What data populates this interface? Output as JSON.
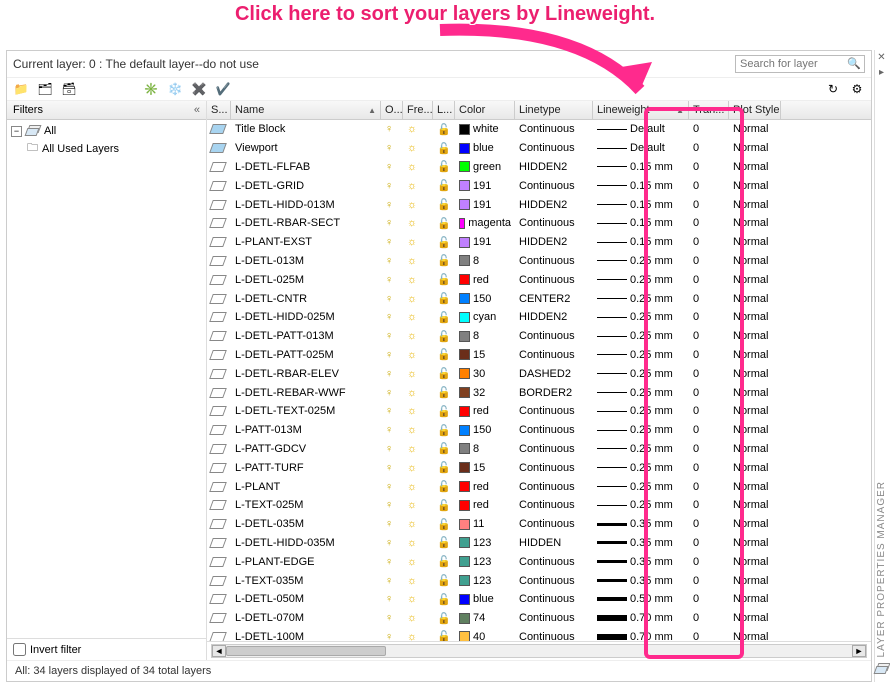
{
  "annotation": "Click here to sort your layers by Lineweight.",
  "title_line": "Current layer: 0 : The default layer--do not use",
  "search_placeholder": "Search for layer",
  "filters": {
    "header": "Filters",
    "root": "All",
    "child": "All Used Layers",
    "invert": "Invert filter"
  },
  "columns": {
    "s": "S...",
    "name": "Name",
    "on": "O...",
    "fre": "Fre...",
    "lock": "L...",
    "color": "Color",
    "ltype": "Linetype",
    "lw": "Lineweight",
    "tran": "Tran...",
    "plot": "Plot Style"
  },
  "status": "All: 34 layers displayed of 34 total layers",
  "side_label": "LAYER PROPERTIES MANAGER",
  "layers": [
    {
      "s": "blue",
      "name": "Title Block",
      "color": "#000000",
      "cname": "white",
      "ltype": "Continuous",
      "lw": "Default",
      "lwpx": 1,
      "tran": "0",
      "plot": "Normal"
    },
    {
      "s": "blue",
      "name": "Viewport",
      "color": "#0000ff",
      "cname": "blue",
      "ltype": "Continuous",
      "lw": "Default",
      "lwpx": 1,
      "tran": "0",
      "plot": "Normal"
    },
    {
      "s": "",
      "name": "L-DETL-FLFAB",
      "color": "#00ff00",
      "cname": "green",
      "ltype": "HIDDEN2",
      "lw": "0.15 mm",
      "lwpx": 1,
      "tran": "0",
      "plot": "Normal"
    },
    {
      "s": "",
      "name": "L-DETL-GRID",
      "color": "#c080ff",
      "cname": "191",
      "ltype": "Continuous",
      "lw": "0.15 mm",
      "lwpx": 1,
      "tran": "0",
      "plot": "Normal"
    },
    {
      "s": "",
      "name": "L-DETL-HIDD-013M",
      "color": "#c080ff",
      "cname": "191",
      "ltype": "HIDDEN2",
      "lw": "0.15 mm",
      "lwpx": 1,
      "tran": "0",
      "plot": "Normal"
    },
    {
      "s": "",
      "name": "L-DETL-RBAR-SECT",
      "color": "#ff00ff",
      "cname": "magenta",
      "ltype": "Continuous",
      "lw": "0.15 mm",
      "lwpx": 1,
      "tran": "0",
      "plot": "Normal"
    },
    {
      "s": "",
      "name": "L-PLANT-EXST",
      "color": "#c080ff",
      "cname": "191",
      "ltype": "HIDDEN2",
      "lw": "0.15 mm",
      "lwpx": 1,
      "tran": "0",
      "plot": "Normal"
    },
    {
      "s": "",
      "name": "L-DETL-013M",
      "color": "#808080",
      "cname": "8",
      "ltype": "Continuous",
      "lw": "0.25 mm",
      "lwpx": 1,
      "tran": "0",
      "plot": "Normal"
    },
    {
      "s": "",
      "name": "L-DETL-025M",
      "color": "#ff0000",
      "cname": "red",
      "ltype": "Continuous",
      "lw": "0.25 mm",
      "lwpx": 1,
      "tran": "0",
      "plot": "Normal"
    },
    {
      "s": "",
      "name": "L-DETL-CNTR",
      "color": "#0080ff",
      "cname": "150",
      "ltype": "CENTER2",
      "lw": "0.25 mm",
      "lwpx": 1,
      "tran": "0",
      "plot": "Normal"
    },
    {
      "s": "",
      "name": "L-DETL-HIDD-025M",
      "color": "#00ffff",
      "cname": "cyan",
      "ltype": "HIDDEN2",
      "lw": "0.25 mm",
      "lwpx": 1,
      "tran": "0",
      "plot": "Normal"
    },
    {
      "s": "",
      "name": "L-DETL-PATT-013M",
      "color": "#808080",
      "cname": "8",
      "ltype": "Continuous",
      "lw": "0.25 mm",
      "lwpx": 1,
      "tran": "0",
      "plot": "Normal"
    },
    {
      "s": "",
      "name": "L-DETL-PATT-025M",
      "color": "#6b2e1a",
      "cname": "15",
      "ltype": "Continuous",
      "lw": "0.25 mm",
      "lwpx": 1,
      "tran": "0",
      "plot": "Normal"
    },
    {
      "s": "",
      "name": "L-DETL-RBAR-ELEV",
      "color": "#ff8000",
      "cname": "30",
      "ltype": "DASHED2",
      "lw": "0.25 mm",
      "lwpx": 1,
      "tran": "0",
      "plot": "Normal"
    },
    {
      "s": "",
      "name": "L-DETL-REBAR-WWF",
      "color": "#804020",
      "cname": "32",
      "ltype": "BORDER2",
      "lw": "0.25 mm",
      "lwpx": 1,
      "tran": "0",
      "plot": "Normal"
    },
    {
      "s": "",
      "name": "L-DETL-TEXT-025M",
      "color": "#ff0000",
      "cname": "red",
      "ltype": "Continuous",
      "lw": "0.25 mm",
      "lwpx": 1,
      "tran": "0",
      "plot": "Normal"
    },
    {
      "s": "",
      "name": "L-PATT-013M",
      "color": "#0080ff",
      "cname": "150",
      "ltype": "Continuous",
      "lw": "0.25 mm",
      "lwpx": 1,
      "tran": "0",
      "plot": "Normal"
    },
    {
      "s": "",
      "name": "L-PATT-GDCV",
      "color": "#808080",
      "cname": "8",
      "ltype": "Continuous",
      "lw": "0.25 mm",
      "lwpx": 1,
      "tran": "0",
      "plot": "Normal"
    },
    {
      "s": "",
      "name": "L-PATT-TURF",
      "color": "#6b2e1a",
      "cname": "15",
      "ltype": "Continuous",
      "lw": "0.25 mm",
      "lwpx": 1,
      "tran": "0",
      "plot": "Normal"
    },
    {
      "s": "",
      "name": "L-PLANT",
      "color": "#ff0000",
      "cname": "red",
      "ltype": "Continuous",
      "lw": "0.25 mm",
      "lwpx": 1,
      "tran": "0",
      "plot": "Normal"
    },
    {
      "s": "",
      "name": "L-TEXT-025M",
      "color": "#ff0000",
      "cname": "red",
      "ltype": "Continuous",
      "lw": "0.25 mm",
      "lwpx": 1,
      "tran": "0",
      "plot": "Normal"
    },
    {
      "s": "",
      "name": "L-DETL-035M",
      "color": "#ff8080",
      "cname": "11",
      "ltype": "Continuous",
      "lw": "0.35 mm",
      "lwpx": 3,
      "tran": "0",
      "plot": "Normal"
    },
    {
      "s": "",
      "name": "L-DETL-HIDD-035M",
      "color": "#40a090",
      "cname": "123",
      "ltype": "HIDDEN",
      "lw": "0.35 mm",
      "lwpx": 3,
      "tran": "0",
      "plot": "Normal"
    },
    {
      "s": "",
      "name": "L-PLANT-EDGE",
      "color": "#40a090",
      "cname": "123",
      "ltype": "Continuous",
      "lw": "0.35 mm",
      "lwpx": 3,
      "tran": "0",
      "plot": "Normal"
    },
    {
      "s": "",
      "name": "L-TEXT-035M",
      "color": "#40a090",
      "cname": "123",
      "ltype": "Continuous",
      "lw": "0.35 mm",
      "lwpx": 3,
      "tran": "0",
      "plot": "Normal"
    },
    {
      "s": "",
      "name": "L-DETL-050M",
      "color": "#0000ff",
      "cname": "blue",
      "ltype": "Continuous",
      "lw": "0.50 mm",
      "lwpx": 4,
      "tran": "0",
      "plot": "Normal"
    },
    {
      "s": "",
      "name": "L-DETL-070M",
      "color": "#608060",
      "cname": "74",
      "ltype": "Continuous",
      "lw": "0.70 mm",
      "lwpx": 6,
      "tran": "0",
      "plot": "Normal"
    },
    {
      "s": "",
      "name": "L-DETL-100M",
      "color": "#ffc040",
      "cname": "40",
      "ltype": "Continuous",
      "lw": "0.70 mm",
      "lwpx": 6,
      "tran": "0",
      "plot": "Normal"
    }
  ]
}
